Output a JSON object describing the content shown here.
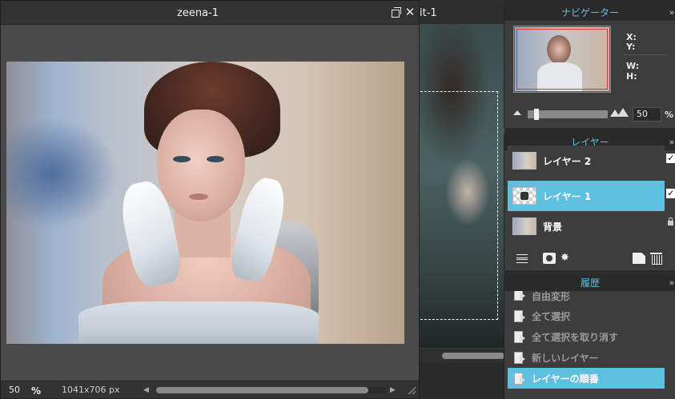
{
  "background_document": {
    "title_fragment": "it-1"
  },
  "document": {
    "title": "zeena-1",
    "zoom_value": "50",
    "zoom_unit": "%",
    "dimensions": "1041x706 px",
    "horizontal_scroll_position": 0.92
  },
  "navigator": {
    "title": "ナビゲーター",
    "x_label": "X:",
    "y_label": "Y:",
    "w_label": "W:",
    "h_label": "H:",
    "zoom_value": "50",
    "zoom_unit": "%"
  },
  "layers": {
    "title": "レイヤー",
    "items": [
      {
        "name": "レイヤー 2",
        "visible": "✓",
        "selected": false
      },
      {
        "name": "レイヤー 1",
        "visible": "✓",
        "selected": true
      },
      {
        "name": "背景",
        "locked": true,
        "selected": false
      }
    ],
    "tool_fx": "✸"
  },
  "history": {
    "title": "履歴",
    "items": [
      {
        "label": "自由変形"
      },
      {
        "label": "全て選択"
      },
      {
        "label": "全て選択を取り消す"
      },
      {
        "label": "新しいレイヤー"
      },
      {
        "label": "レイヤーの順番",
        "selected": true
      }
    ]
  },
  "icons": {
    "close": "✕",
    "collapse": "»"
  },
  "colors": {
    "accent": "#5ec0de",
    "selection_rect": "#e03030"
  }
}
